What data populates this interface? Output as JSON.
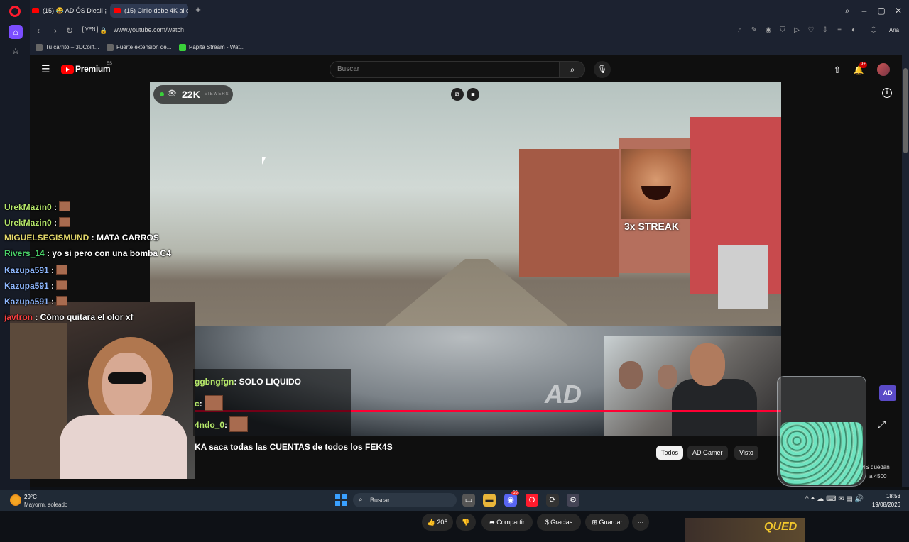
{
  "browser": {
    "tabs": [
      {
        "label": "(15) 😂 ADIÓS Dieali ¡FE"
      },
      {
        "label": "(15) Cirilo debe 4K al due"
      }
    ],
    "url": "www.youtube.com/watch",
    "vpn_label": "VPN",
    "ai_label": "Aria",
    "bookmarks": [
      {
        "label": "Tu carrito – 3DCoiff..."
      },
      {
        "label": "Fuerte extensión de..."
      },
      {
        "label": "Papita Stream - Wat..."
      }
    ]
  },
  "youtube": {
    "logo_text": "Premium",
    "country": "ES",
    "search_placeholder": "Buscar",
    "notif_count": "9+",
    "video_title": "KA saca todas las CUENTAS de todos los FEK4S",
    "likes": "205",
    "actions": {
      "share": "Compartir",
      "thanks": "Gracias",
      "save": "Guardar",
      "more": "⋯"
    },
    "filters": [
      "Todos",
      "AD Gamer",
      "Visto"
    ],
    "related_side_line1": "4S quedan",
    "related_side_line2": "a 4500",
    "related_overlay": "QUED"
  },
  "stream": {
    "viewers": "22K",
    "viewers_label": "VIEWERS",
    "streak": "3x STREAK",
    "watermark": "AD",
    "progress_fraction": 1.0,
    "chat": [
      {
        "user": "UrekMazin0",
        "msg": "",
        "emote": true,
        "color": "#b6e86a"
      },
      {
        "user": "UrekMazin0",
        "msg": "",
        "emote": true,
        "color": "#b6e86a"
      },
      {
        "user": "MIGUELSEGISMUND",
        "msg": "MATA CARROS",
        "emote": false,
        "color": "#e3d86a"
      },
      {
        "user": "Rivers_14",
        "msg": "yo si pero con una bomba C4",
        "emote": false,
        "color": "#4ad46a"
      },
      {
        "user": "Kazupa591",
        "msg": "",
        "emote": true,
        "color": "#8fb8ff"
      },
      {
        "user": "Kazupa591",
        "msg": "",
        "emote": true,
        "color": "#8fb8ff"
      },
      {
        "user": "Kazupa591",
        "msg": "",
        "emote": true,
        "color": "#8fb8ff"
      },
      {
        "user": "javtron",
        "msg": "Cómo quitara el olor xf",
        "emote": false,
        "color": "#ff4040"
      }
    ],
    "chat2": [
      {
        "user": "ggbngfgn",
        "msg": "SOLO LIQUIDO",
        "emote": false
      },
      {
        "user": "c",
        "msg": "",
        "emote": true
      },
      {
        "user": "4ndo_0",
        "msg": "",
        "emote": true
      }
    ]
  },
  "taskbar": {
    "temp": "29°C",
    "weather": "Mayorm. soleado",
    "search": "Buscar",
    "messenger_badge": "55",
    "time": "18:53",
    "date": "19/08/2026"
  },
  "colors": {
    "accent_red": "#ff0033",
    "chat_user_green": "#b6e86a"
  }
}
